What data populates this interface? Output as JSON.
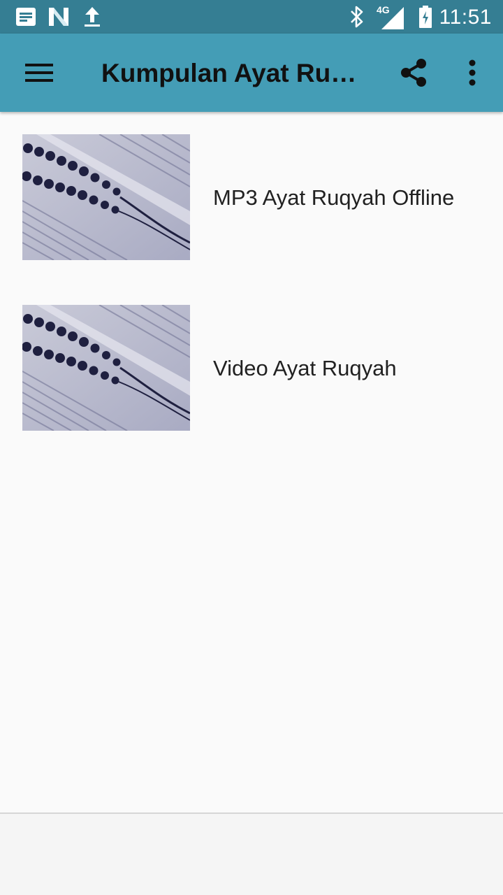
{
  "status_bar": {
    "time": "11:51",
    "network": "4G",
    "icons": [
      "notes-icon",
      "n-notification-icon",
      "upload-icon",
      "bluetooth-icon",
      "signal-icon",
      "battery-icon"
    ]
  },
  "app_bar": {
    "title": "Kumpulan Ayat Ruq…",
    "menu_icon": "hamburger-menu-icon",
    "share_icon": "share-icon",
    "overflow_icon": "more-vert-icon"
  },
  "menu_items": [
    {
      "label": "MP3 Ayat Ruqyah Offline",
      "thumbnail": "quran-prayer-beads-image"
    },
    {
      "label": "Video Ayat Ruqyah",
      "thumbnail": "quran-prayer-beads-image"
    }
  ],
  "colors": {
    "status_bar": "#357e93",
    "app_bar": "#449db6",
    "background": "#fafafa",
    "text_primary": "#212121"
  }
}
